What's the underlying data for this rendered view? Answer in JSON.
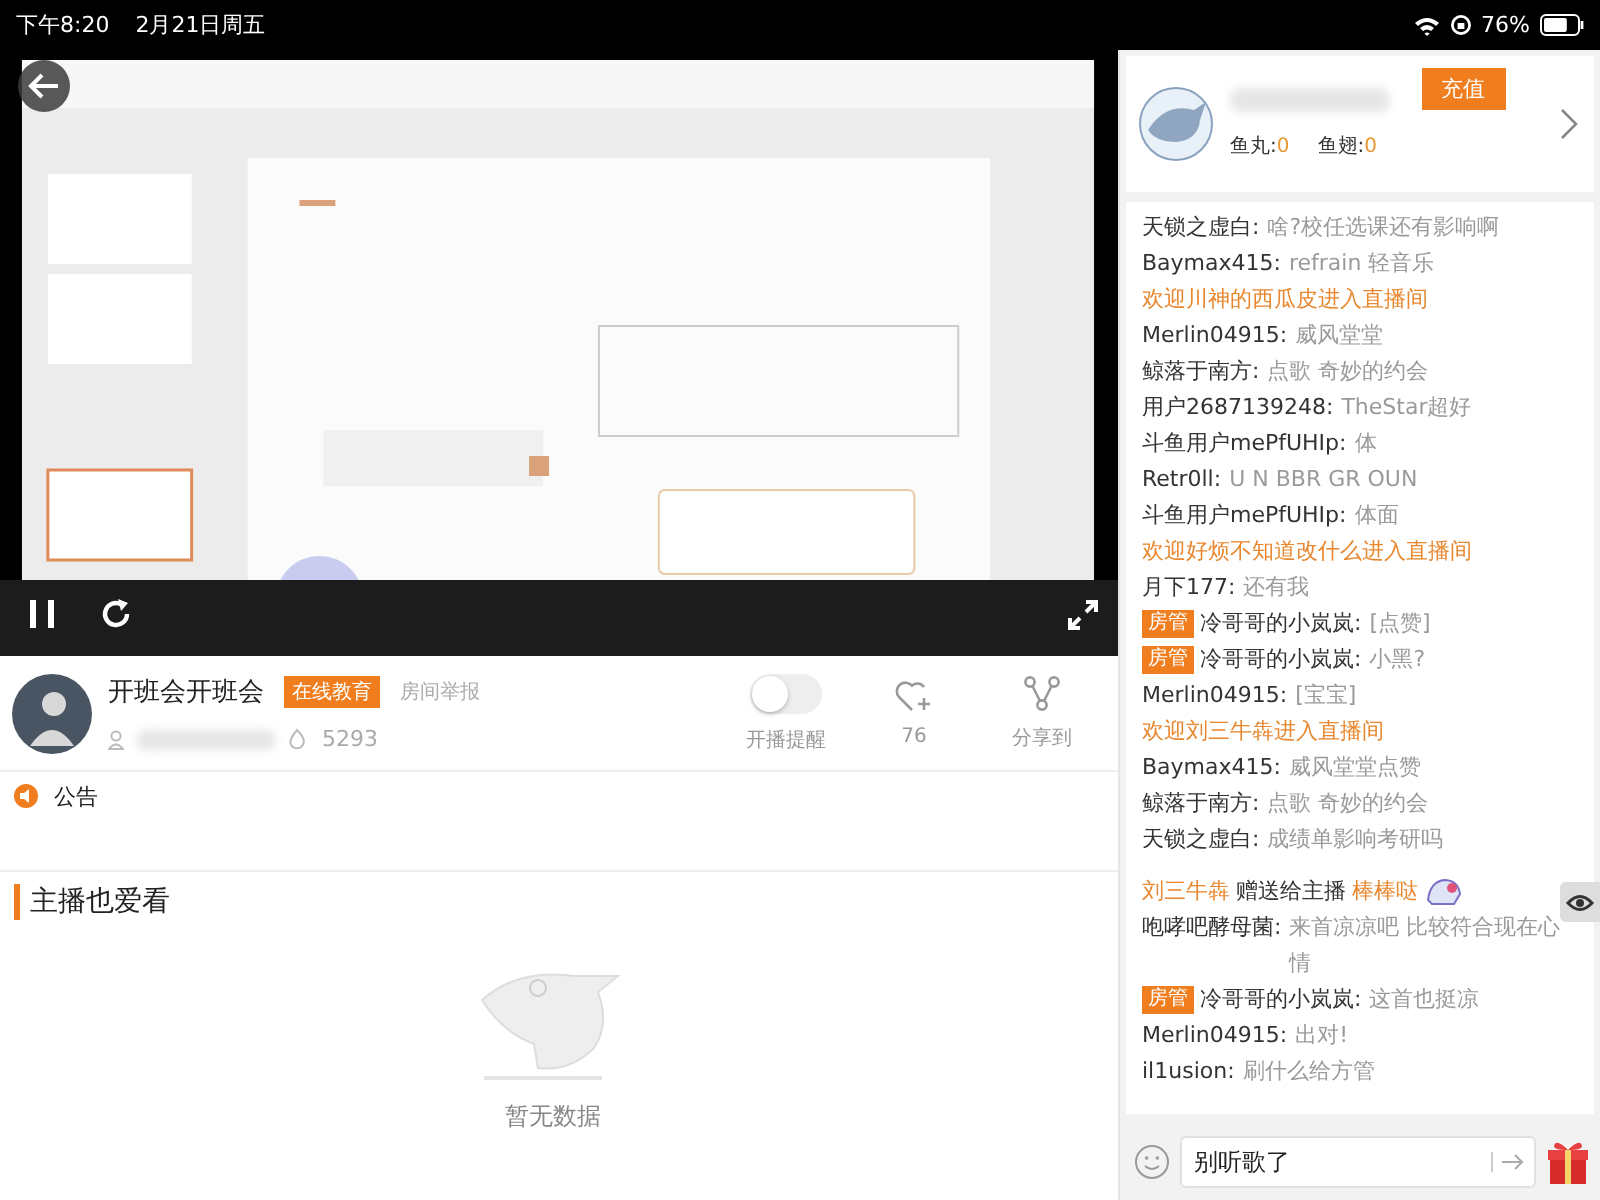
{
  "status_bar": {
    "time": "下午8:20",
    "date": "2月21日周五",
    "battery": "76%"
  },
  "video": {
    "playing": true
  },
  "room": {
    "title": "开班会开班会",
    "category": "在线教育",
    "report": "房间举报",
    "heat": "5293",
    "reminder": {
      "label": "开播提醒",
      "on": false
    },
    "follow": {
      "count": "76"
    },
    "share": {
      "label": "分享到"
    }
  },
  "notice": {
    "label": "公告"
  },
  "recommend": {
    "title": "主播也爱看",
    "empty_text": "暂无数据"
  },
  "account": {
    "recharge": "充值",
    "balances": [
      {
        "label": "鱼丸:",
        "value": "0"
      },
      {
        "label": "鱼翅:",
        "value": "0"
      }
    ]
  },
  "chat": [
    {
      "kind": "message",
      "user": "天锁之虚白:",
      "text": "啥?校任选课还有影响啊"
    },
    {
      "kind": "message",
      "user": "Baymax415:",
      "text": "refrain 轻音乐"
    },
    {
      "kind": "welcome",
      "text": "欢迎川神的西瓜皮进入直播间"
    },
    {
      "kind": "message",
      "user": "Merlin04915:",
      "text": "威风堂堂"
    },
    {
      "kind": "message",
      "user": "鲸落于南方:",
      "text": "点歌 奇妙的约会"
    },
    {
      "kind": "message",
      "user": "用户2687139248:",
      "text": "TheStar超好"
    },
    {
      "kind": "message",
      "user": "斗鱼用户mePfUHIp:",
      "text": "体"
    },
    {
      "kind": "message",
      "user": "Retr0ll:",
      "text": "U N BBR GR OUN"
    },
    {
      "kind": "message",
      "user": "斗鱼用户mePfUHIp:",
      "text": "体面"
    },
    {
      "kind": "welcome",
      "text": "欢迎好烦不知道改什么进入直播间"
    },
    {
      "kind": "message",
      "user": "月下177:",
      "text": "还有我"
    },
    {
      "kind": "message",
      "badge": "房管",
      "user": "冷哥哥的小岚岚:",
      "text": "[点赞]"
    },
    {
      "kind": "message",
      "badge": "房管",
      "user": "冷哥哥的小岚岚:",
      "text": "小黑?"
    },
    {
      "kind": "message",
      "user": "Merlin04915:",
      "text": "[宝宝]"
    },
    {
      "kind": "welcome",
      "text": "欢迎刘三牛犇进入直播间"
    },
    {
      "kind": "message",
      "user": "Baymax415:",
      "text": "威风堂堂点赞"
    },
    {
      "kind": "message",
      "user": "鲸落于南方:",
      "text": "点歌 奇妙的约会"
    },
    {
      "kind": "message",
      "user": "天锁之虚白:",
      "text": "成绩单影响考研吗"
    },
    {
      "kind": "gift",
      "user": "刘三牛犇",
      "text": "赠送给主播",
      "gift": "棒棒哒"
    },
    {
      "kind": "message",
      "user": "咆哮吧酵母菌:",
      "text": "来首凉凉吧 比较符合现在心情"
    },
    {
      "kind": "message",
      "badge": "房管",
      "user": "冷哥哥的小岚岚:",
      "text": "这首也挺凉"
    },
    {
      "kind": "message",
      "user": "Merlin04915:",
      "text": "出对!"
    },
    {
      "kind": "message",
      "user": "il1usion:",
      "text": "刷什么给方管"
    }
  ],
  "input": {
    "value": "别听歌了"
  }
}
